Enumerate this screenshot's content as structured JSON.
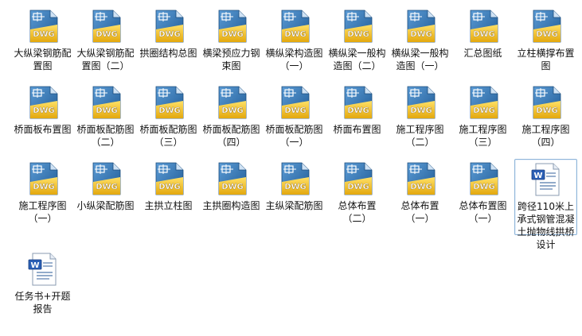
{
  "files": [
    {
      "name": "大纵梁钢筋配置图",
      "type": "dwg",
      "icon": "dwg-file-icon",
      "selected": false
    },
    {
      "name": "大纵梁钢筋配置图（二）",
      "type": "dwg",
      "icon": "dwg-file-icon",
      "selected": false
    },
    {
      "name": "拱圈结构总图",
      "type": "dwg",
      "icon": "dwg-file-icon",
      "selected": false
    },
    {
      "name": "横梁预应力钢束图",
      "type": "dwg",
      "icon": "dwg-file-icon",
      "selected": false
    },
    {
      "name": "横纵梁构造图（一）",
      "type": "dwg",
      "icon": "dwg-file-icon",
      "selected": false
    },
    {
      "name": "横纵梁一般构造图（二）",
      "type": "dwg",
      "icon": "dwg-file-icon",
      "selected": false
    },
    {
      "name": "横纵梁一般构造图（一）",
      "type": "dwg",
      "icon": "dwg-file-icon",
      "selected": false
    },
    {
      "name": "汇总图纸",
      "type": "dwg",
      "icon": "dwg-file-icon",
      "selected": false
    },
    {
      "name": "立柱横撑布置图",
      "type": "dwg",
      "icon": "dwg-file-icon",
      "selected": false
    },
    {
      "name": "桥面板布置图",
      "type": "dwg",
      "icon": "dwg-file-icon",
      "selected": false
    },
    {
      "name": "桥面板配筋图（二）",
      "type": "dwg",
      "icon": "dwg-file-icon",
      "selected": false
    },
    {
      "name": "桥面板配筋图（三）",
      "type": "dwg",
      "icon": "dwg-file-icon",
      "selected": false
    },
    {
      "name": "桥面板配筋图（四）",
      "type": "dwg",
      "icon": "dwg-file-icon",
      "selected": false
    },
    {
      "name": "桥面板配筋图（一）",
      "type": "dwg",
      "icon": "dwg-file-icon",
      "selected": false
    },
    {
      "name": "桥面布置图",
      "type": "dwg",
      "icon": "dwg-file-icon",
      "selected": false
    },
    {
      "name": "施工程序图（二）",
      "type": "dwg",
      "icon": "dwg-file-icon",
      "selected": false
    },
    {
      "name": "施工程序图（三）",
      "type": "dwg",
      "icon": "dwg-file-icon",
      "selected": false
    },
    {
      "name": "施工程序图（四）",
      "type": "dwg",
      "icon": "dwg-file-icon",
      "selected": false
    },
    {
      "name": "施工程序图（一）",
      "type": "dwg",
      "icon": "dwg-file-icon",
      "selected": false
    },
    {
      "name": "小纵梁配筋图",
      "type": "dwg",
      "icon": "dwg-file-icon",
      "selected": false
    },
    {
      "name": "主拱立柱图",
      "type": "dwg",
      "icon": "dwg-file-icon",
      "selected": false
    },
    {
      "name": "主拱圈构造图",
      "type": "dwg",
      "icon": "dwg-file-icon",
      "selected": false
    },
    {
      "name": "主纵梁配筋图",
      "type": "dwg",
      "icon": "dwg-file-icon",
      "selected": false
    },
    {
      "name": "总体布置（二）",
      "type": "dwg",
      "icon": "dwg-file-icon",
      "selected": false
    },
    {
      "name": "总体布置（一）",
      "type": "dwg",
      "icon": "dwg-file-icon",
      "selected": false
    },
    {
      "name": "总体布置图（一）",
      "type": "dwg",
      "icon": "dwg-file-icon",
      "selected": false
    },
    {
      "name": "跨径110米上承式钢管混凝土抛物线拱桥设计",
      "type": "doc",
      "icon": "word-document-icon",
      "selected": true
    },
    {
      "name": "任务书+开题报告",
      "type": "doc",
      "icon": "word-document-icon",
      "selected": false
    }
  ],
  "icon_labels": {
    "dwg": "DWG"
  },
  "colors": {
    "dwg_blue": "#2d6ea8",
    "dwg_yellow": "#f4c21a",
    "word_blue": "#2b5fb5",
    "selection_border": "#8fb5d9"
  }
}
